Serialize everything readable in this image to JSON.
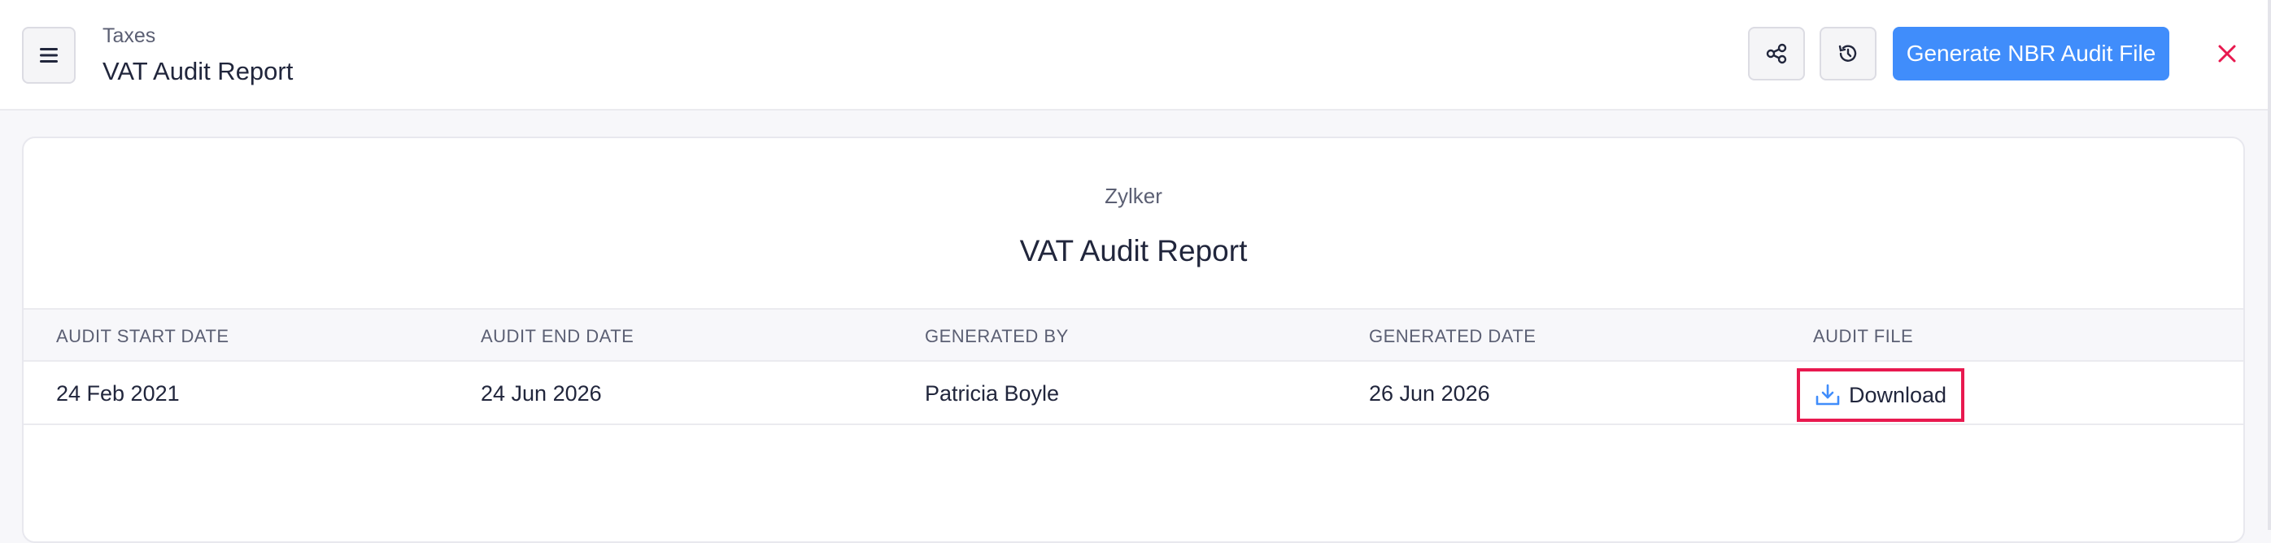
{
  "header": {
    "breadcrumb": "Taxes",
    "title": "VAT Audit Report",
    "primary_action": "Generate NBR Audit File"
  },
  "report": {
    "organization": "Zylker",
    "title": "VAT Audit Report"
  },
  "table": {
    "columns": [
      "AUDIT START DATE",
      "AUDIT END DATE",
      "GENERATED BY",
      "GENERATED DATE",
      "AUDIT FILE"
    ],
    "rows": [
      {
        "audit_start_date": "24 Feb 2021",
        "audit_end_date": "24 Jun 2026",
        "generated_by": "Patricia Boyle",
        "generated_date": "26 Jun 2026",
        "audit_file": "Download"
      }
    ]
  },
  "icons": {
    "menu": "hamburger-menu-icon",
    "share": "share-icon",
    "history": "history-icon",
    "close": "close-icon",
    "download": "download-icon"
  },
  "colors": {
    "accent": "#408dfb",
    "close": "#e8194f",
    "highlight_border": "#e8194f"
  }
}
